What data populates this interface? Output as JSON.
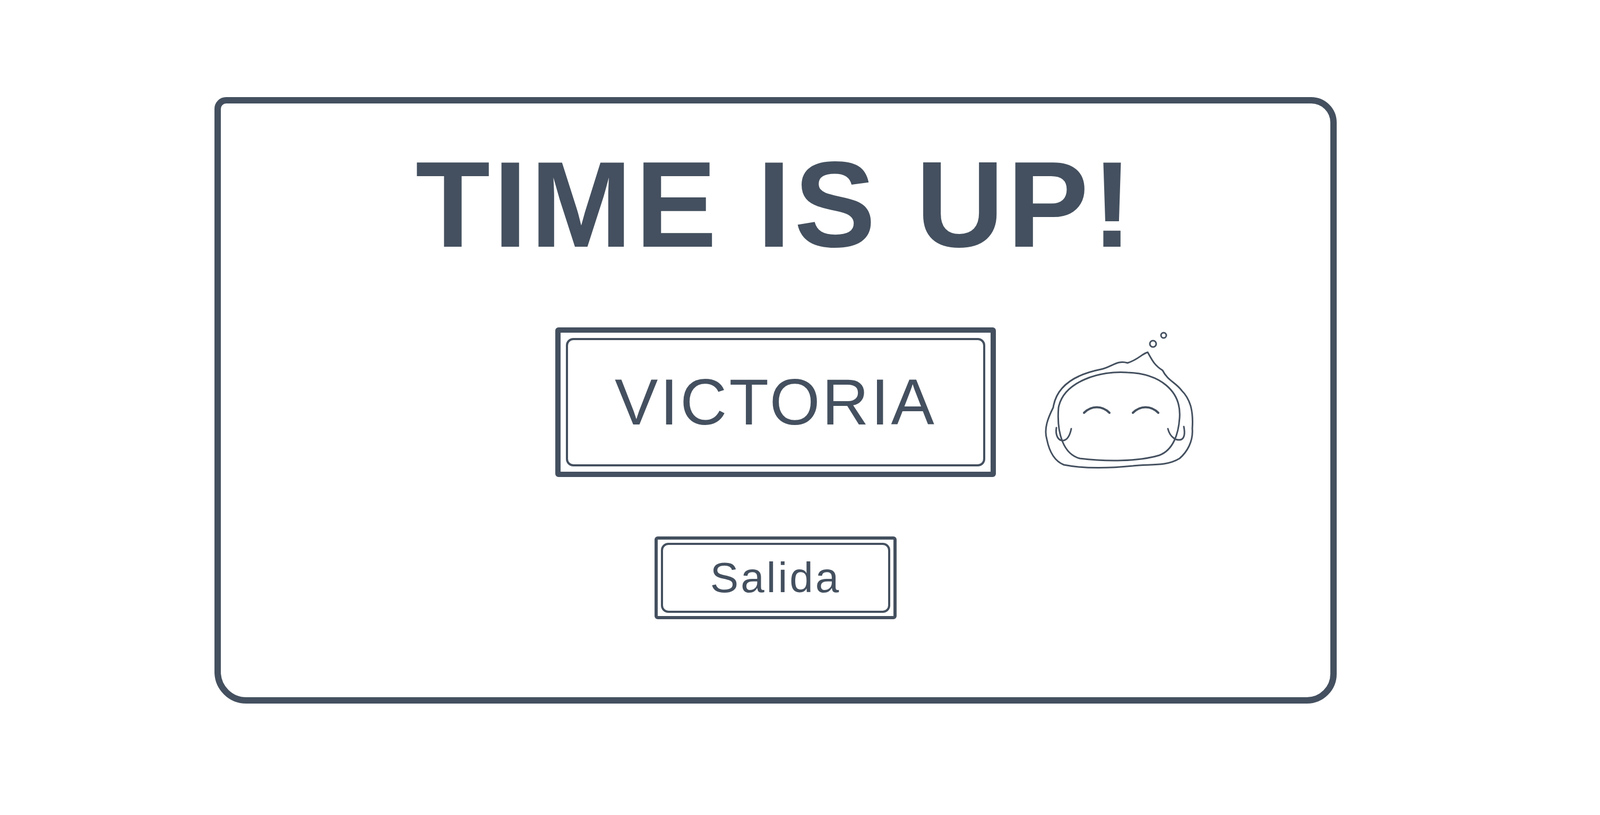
{
  "screen": {
    "title": "TIME IS UP!"
  },
  "player": {
    "name": "VICTORIA"
  },
  "buttons": [
    {
      "label": "Salida"
    }
  ]
}
